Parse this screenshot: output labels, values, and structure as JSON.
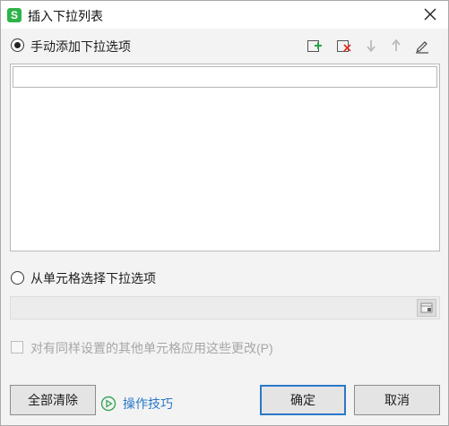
{
  "window": {
    "title": "插入下拉列表",
    "app_icon_letter": "S",
    "accent_color": "#2fb34a"
  },
  "manual_option": {
    "label": "手动添加下拉选项",
    "selected": true,
    "toolbar": [
      "add-item-icon",
      "delete-item-icon",
      "move-down-icon",
      "move-up-icon",
      "edit-icon"
    ],
    "items": [
      {
        "value": ""
      }
    ]
  },
  "cell_option": {
    "label": "从单元格选择下拉选项",
    "selected": false,
    "range_value": ""
  },
  "apply_changes": {
    "label": "对有同样设置的其他单元格应用这些更改(P)",
    "checked": false,
    "disabled": true
  },
  "footer": {
    "clear_all_label": "全部清除",
    "tips_label": "操作技巧",
    "ok_label": "确定",
    "cancel_label": "取消",
    "link_color": "#2a78c9"
  }
}
